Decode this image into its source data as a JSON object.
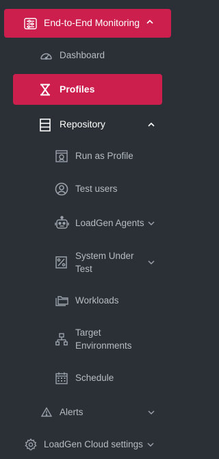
{
  "colors": {
    "sidebar_bg": "#2b3036",
    "accent": "#cc1f4e",
    "text": "#b6bcc4",
    "icon": "#9aa1aa"
  },
  "nav": {
    "monitoring": {
      "label": "End-to-End Monitoring",
      "icon": "monitoring-icon",
      "expanded": true
    },
    "dashboard": {
      "label": "Dashboard",
      "icon": "speedometer-icon"
    },
    "profiles": {
      "label": "Profiles",
      "icon": "hourglass-icon",
      "active": true
    },
    "repository": {
      "label": "Repository",
      "icon": "repository-icon",
      "expanded": true
    },
    "run_as_profile": {
      "label": "Run as Profile",
      "icon": "profile-card-icon"
    },
    "test_users": {
      "label": "Test users",
      "icon": "user-circle-icon"
    },
    "loadgen_agents": {
      "label": "LoadGen Agents",
      "icon": "robot-icon"
    },
    "system_under_test": {
      "label_1": "System Under",
      "label_2": "Test",
      "icon": "percent-icon"
    },
    "workloads": {
      "label": "Workloads",
      "icon": "folders-icon"
    },
    "target_environments": {
      "label_1": "Target",
      "label_2": "Environments",
      "icon": "network-icon"
    },
    "schedule": {
      "label": "Schedule",
      "icon": "calendar-icon"
    },
    "alerts": {
      "label": "Alerts",
      "icon": "warning-icon"
    },
    "loadgen_cloud_settings": {
      "label": "LoadGen Cloud settings",
      "icon": "gear-icon"
    }
  }
}
